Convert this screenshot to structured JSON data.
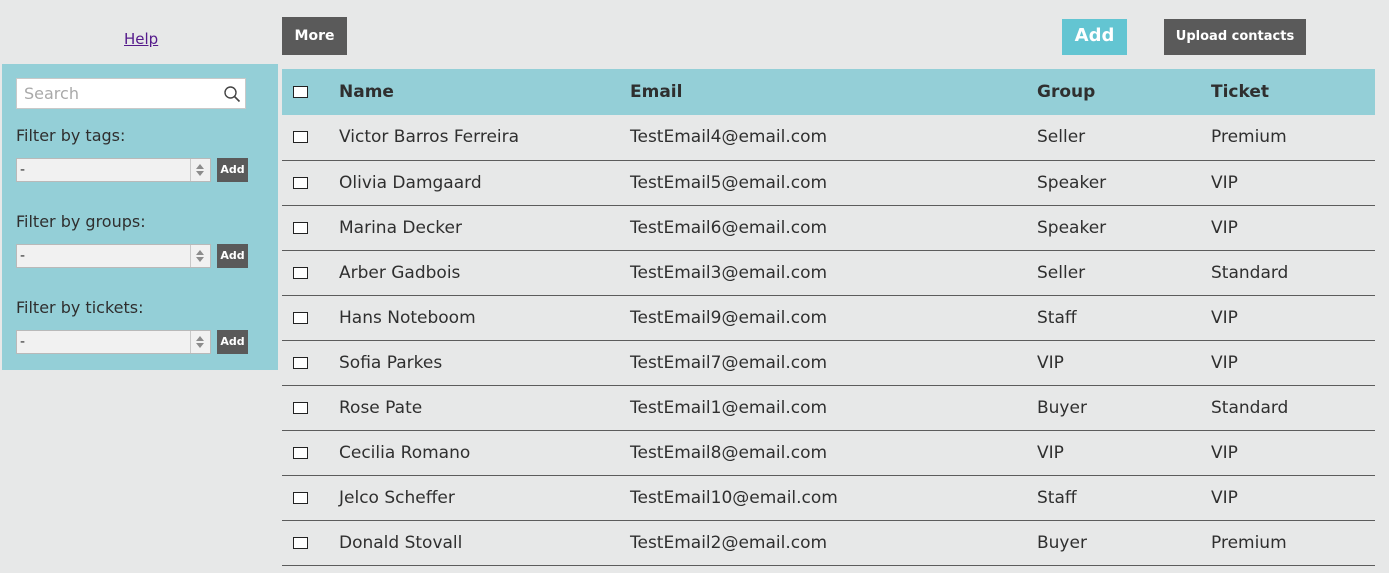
{
  "header": {
    "help_label": "Help",
    "more_label": "More",
    "add_label": "Add",
    "upload_label": "Upload contacts"
  },
  "sidebar": {
    "search_placeholder": "Search",
    "filters": [
      {
        "label": "Filter by tags:",
        "value": "-",
        "add_label": "Add"
      },
      {
        "label": "Filter by groups:",
        "value": "-",
        "add_label": "Add"
      },
      {
        "label": "Filter by tickets:",
        "value": "-",
        "add_label": "Add"
      }
    ]
  },
  "table": {
    "columns": [
      "Name",
      "Email",
      "Group",
      "Ticket"
    ],
    "rows": [
      {
        "name": "Victor Barros Ferreira",
        "email": "TestEmail4@email.com",
        "group": "Seller",
        "ticket": "Premium"
      },
      {
        "name": "Olivia Damgaard",
        "email": "TestEmail5@email.com",
        "group": "Speaker",
        "ticket": "VIP"
      },
      {
        "name": "Marina Decker",
        "email": "TestEmail6@email.com",
        "group": "Speaker",
        "ticket": "VIP"
      },
      {
        "name": "Arber Gadbois",
        "email": "TestEmail3@email.com",
        "group": "Seller",
        "ticket": "Standard"
      },
      {
        "name": "Hans Noteboom",
        "email": "TestEmail9@email.com",
        "group": "Staff",
        "ticket": "VIP"
      },
      {
        "name": "Sofia Parkes",
        "email": "TestEmail7@email.com",
        "group": "VIP",
        "ticket": "VIP"
      },
      {
        "name": "Rose Pate",
        "email": "TestEmail1@email.com",
        "group": "Buyer",
        "ticket": "Standard"
      },
      {
        "name": "Cecilia Romano",
        "email": "TestEmail8@email.com",
        "group": "VIP",
        "ticket": "VIP"
      },
      {
        "name": "Jelco Scheffer",
        "email": "TestEmail10@email.com",
        "group": "Staff",
        "ticket": "VIP"
      },
      {
        "name": "Donald Stovall",
        "email": "TestEmail2@email.com",
        "group": "Buyer",
        "ticket": "Premium"
      }
    ]
  },
  "colors": {
    "accent": "#94cfd7",
    "add_button": "#63c5d2",
    "dark_button": "#5a5a5a",
    "background": "#e7e8e8"
  },
  "icons": {
    "search": "search-icon"
  }
}
